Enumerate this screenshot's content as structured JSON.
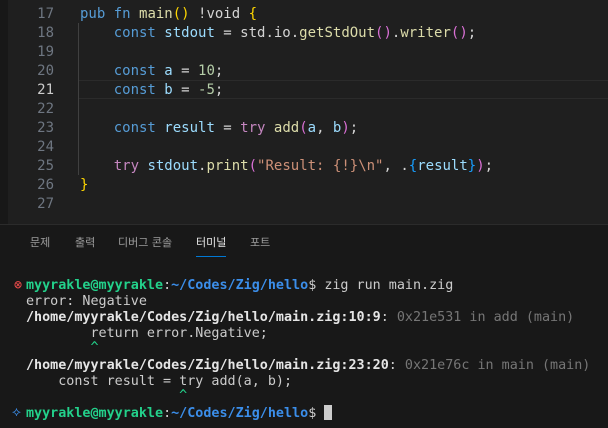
{
  "editor": {
    "current_line": 21,
    "lines": [
      {
        "n": 17,
        "tokens": [
          [
            "pub fn ",
            "kw"
          ],
          [
            "main",
            "fn"
          ],
          [
            "()",
            "b1"
          ],
          [
            " !void ",
            "op"
          ],
          [
            "{",
            "b1"
          ]
        ]
      },
      {
        "n": 18,
        "tokens": [
          [
            "    const ",
            "kw"
          ],
          [
            "stdout",
            "var"
          ],
          [
            " = std.io.",
            "op"
          ],
          [
            "getStdOut",
            "fn"
          ],
          [
            "()",
            "b2"
          ],
          [
            ".",
            "op"
          ],
          [
            "writer",
            "fn"
          ],
          [
            "()",
            "b2"
          ],
          [
            ";",
            "op"
          ]
        ]
      },
      {
        "n": 19,
        "tokens": []
      },
      {
        "n": 20,
        "tokens": [
          [
            "    const ",
            "kw"
          ],
          [
            "a",
            "var"
          ],
          [
            " = ",
            "op"
          ],
          [
            "10",
            "num"
          ],
          [
            ";",
            "op"
          ]
        ]
      },
      {
        "n": 21,
        "tokens": [
          [
            "    const ",
            "kw"
          ],
          [
            "b",
            "var"
          ],
          [
            " = ",
            "op"
          ],
          [
            "-5",
            "num"
          ],
          [
            ";",
            "op"
          ]
        ]
      },
      {
        "n": 22,
        "tokens": []
      },
      {
        "n": 23,
        "tokens": [
          [
            "    const ",
            "kw"
          ],
          [
            "result",
            "var"
          ],
          [
            " = ",
            "op"
          ],
          [
            "try ",
            "ctl"
          ],
          [
            "add",
            "fn"
          ],
          [
            "(",
            "b2"
          ],
          [
            "a",
            "var"
          ],
          [
            ", ",
            "op"
          ],
          [
            "b",
            "var"
          ],
          [
            ")",
            "b2"
          ],
          [
            ";",
            "op"
          ]
        ]
      },
      {
        "n": 24,
        "tokens": []
      },
      {
        "n": 25,
        "tokens": [
          [
            "    try ",
            "ctl"
          ],
          [
            "stdout",
            "var"
          ],
          [
            ".",
            "op"
          ],
          [
            "print",
            "fn"
          ],
          [
            "(",
            "b2"
          ],
          [
            "\"Result: {!}\\n\"",
            "str"
          ],
          [
            ", .",
            "op"
          ],
          [
            "{",
            "b3"
          ],
          [
            "result",
            "var"
          ],
          [
            "}",
            "b3"
          ],
          [
            ")",
            "b2"
          ],
          [
            ";",
            "op"
          ]
        ]
      },
      {
        "n": 26,
        "tokens": [
          [
            "}",
            "b1"
          ]
        ]
      },
      {
        "n": 27,
        "tokens": []
      }
    ]
  },
  "panel": {
    "tabs": [
      "문제",
      "출력",
      "디버그 콘솔",
      "터미널",
      "포트"
    ],
    "active_tab": "터미널"
  },
  "terminal": {
    "user_host": "myyrakle@myyrakle",
    "path": "~/Codes/Zig/hello",
    "command": "zig run main.zig",
    "error_line": "error: Negative",
    "frame1_loc": "/home/myyrakle/Codes/Zig/hello/main.zig:10:9",
    "frame1_addr": "0x21e531 in add (main)",
    "frame1_src": "        return error.Negative;",
    "frame1_caret": "        ^",
    "frame2_loc": "/home/myyrakle/Codes/Zig/hello/main.zig:23:20",
    "frame2_addr": "0x21e76c in main (main)",
    "frame2_src": "    const result = try add(a, b);",
    "frame2_caret": "                   ^",
    "error_icon": "⊗",
    "prompt_icon": "⟡"
  }
}
